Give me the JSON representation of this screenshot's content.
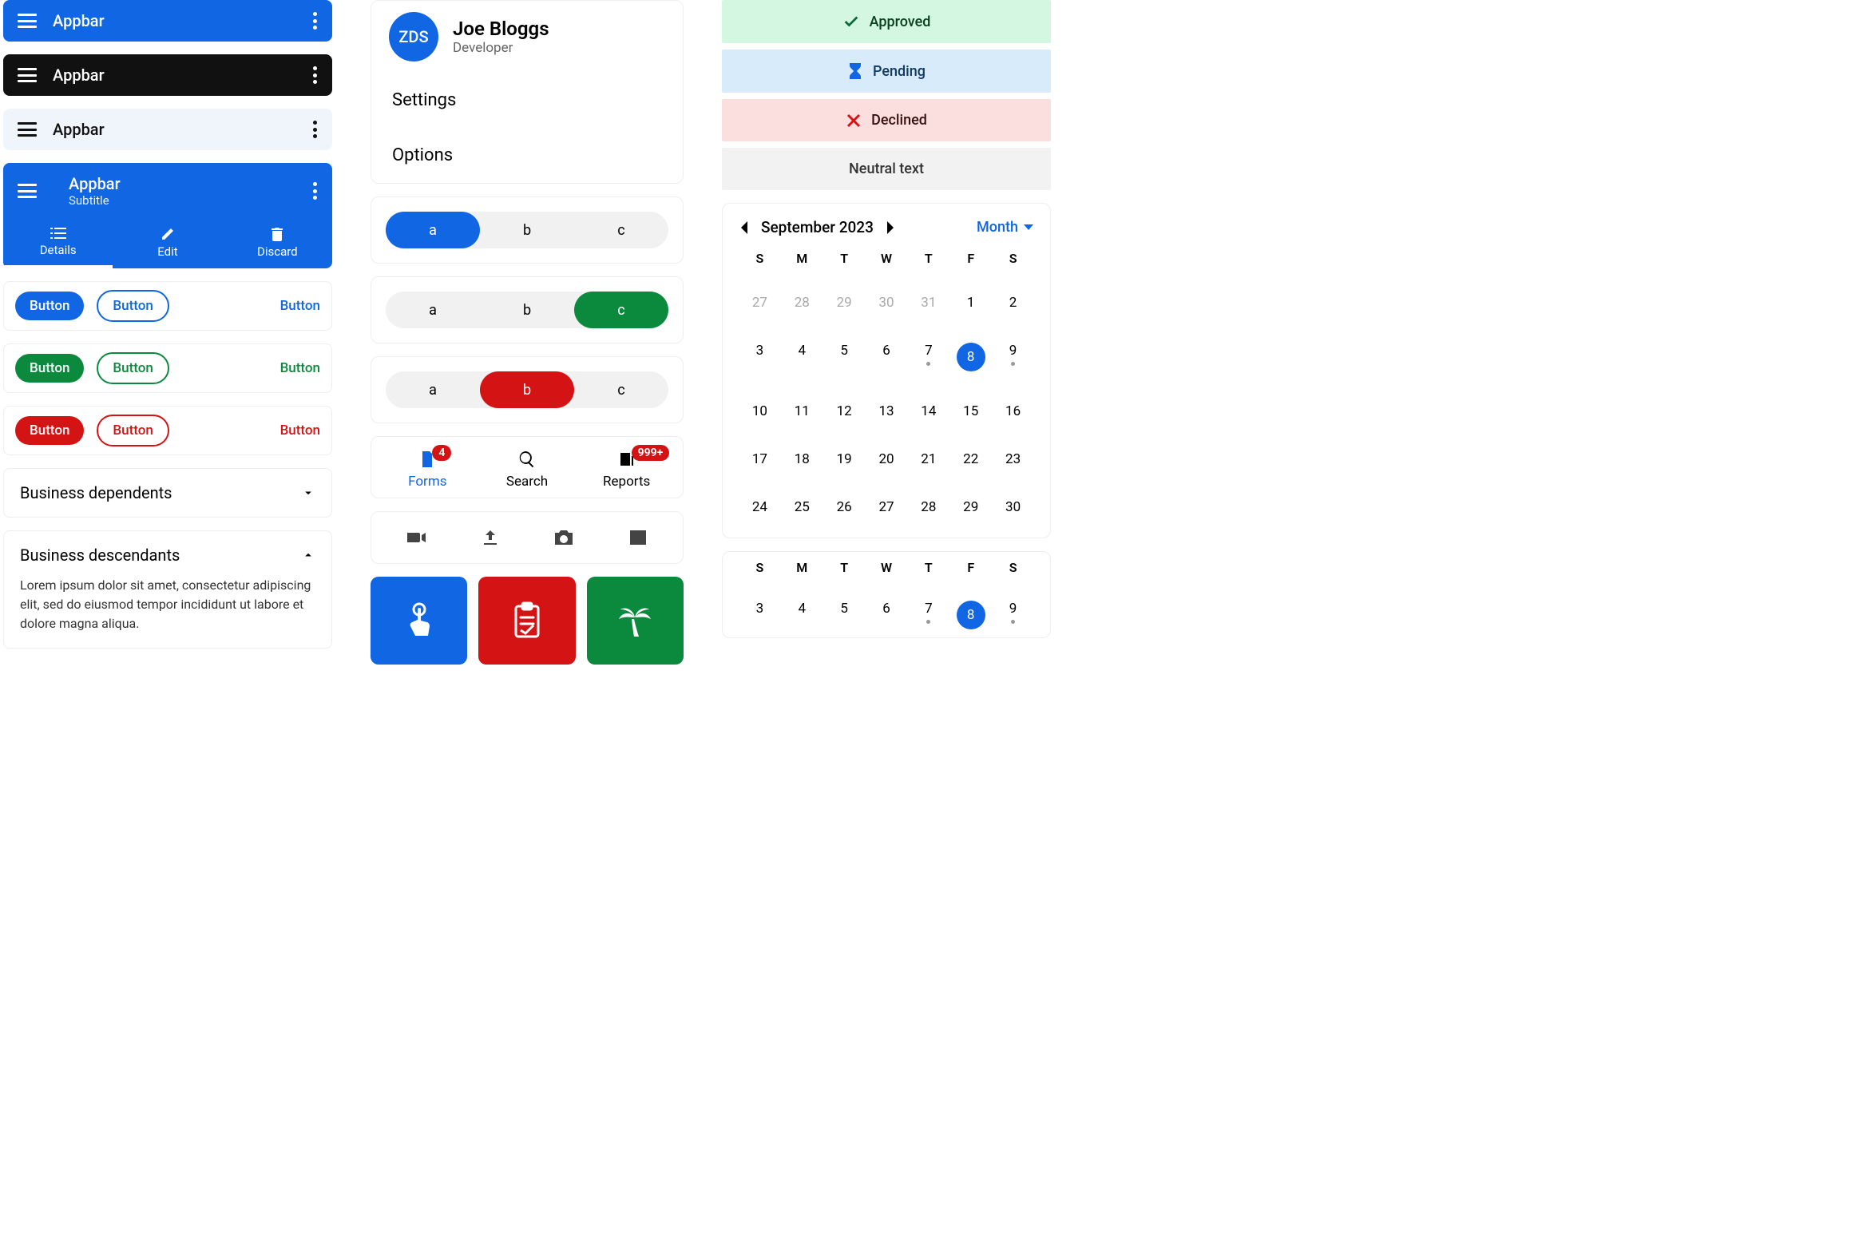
{
  "appbars": {
    "a1": "Appbar",
    "a2": "Appbar",
    "a3": "Appbar",
    "a4_title": "Appbar",
    "a4_subtitle": "Subtitle",
    "tabs": {
      "t1": "Details",
      "t2": "Edit",
      "t3": "Discard"
    }
  },
  "buttons": {
    "label": "Button"
  },
  "accordion": {
    "a1": "Business dependents",
    "a2": "Business descendants",
    "body": "Lorem ipsum dolor sit amet, consectetur adipiscing elit, sed do eiusmod tempor incididunt ut labore et dolore magna aliqua."
  },
  "profile": {
    "initials": "ZDS",
    "name": "Joe Bloggs",
    "role": "Developer",
    "item1": "Settings",
    "item2": "Options"
  },
  "seg": {
    "a": "a",
    "b": "b",
    "c": "c"
  },
  "bnav": {
    "forms": "Forms",
    "search": "Search",
    "reports": "Reports",
    "badge1": "4",
    "badge2": "999+"
  },
  "banners": {
    "approved": "Approved",
    "pending": "Pending",
    "declined": "Declined",
    "neutral": "Neutral text"
  },
  "calendar": {
    "title": "September 2023",
    "mode": "Month",
    "dayheaders": [
      "S",
      "M",
      "T",
      "W",
      "T",
      "F",
      "S"
    ],
    "weeks": [
      [
        {
          "n": "27",
          "out": true
        },
        {
          "n": "28",
          "out": true
        },
        {
          "n": "29",
          "out": true
        },
        {
          "n": "30",
          "out": true
        },
        {
          "n": "31",
          "out": true
        },
        {
          "n": "1"
        },
        {
          "n": "2"
        }
      ],
      [
        {
          "n": "3"
        },
        {
          "n": "4"
        },
        {
          "n": "5"
        },
        {
          "n": "6"
        },
        {
          "n": "7",
          "dot": true
        },
        {
          "n": "8",
          "sel": true
        },
        {
          "n": "9",
          "dot": true
        }
      ],
      [
        {
          "n": "10"
        },
        {
          "n": "11"
        },
        {
          "n": "12"
        },
        {
          "n": "13"
        },
        {
          "n": "14"
        },
        {
          "n": "15"
        },
        {
          "n": "16"
        }
      ],
      [
        {
          "n": "17"
        },
        {
          "n": "18"
        },
        {
          "n": "19"
        },
        {
          "n": "20"
        },
        {
          "n": "21"
        },
        {
          "n": "22"
        },
        {
          "n": "23"
        }
      ],
      [
        {
          "n": "24"
        },
        {
          "n": "25"
        },
        {
          "n": "26"
        },
        {
          "n": "27"
        },
        {
          "n": "28"
        },
        {
          "n": "29"
        },
        {
          "n": "30"
        }
      ]
    ],
    "week2_header": [
      "S",
      "M",
      "T",
      "W",
      "T",
      "F",
      "S"
    ],
    "week2": [
      {
        "n": "3"
      },
      {
        "n": "4"
      },
      {
        "n": "5"
      },
      {
        "n": "6"
      },
      {
        "n": "7",
        "dot": true
      },
      {
        "n": "8",
        "sel": true
      },
      {
        "n": "9",
        "dot": true
      }
    ]
  }
}
